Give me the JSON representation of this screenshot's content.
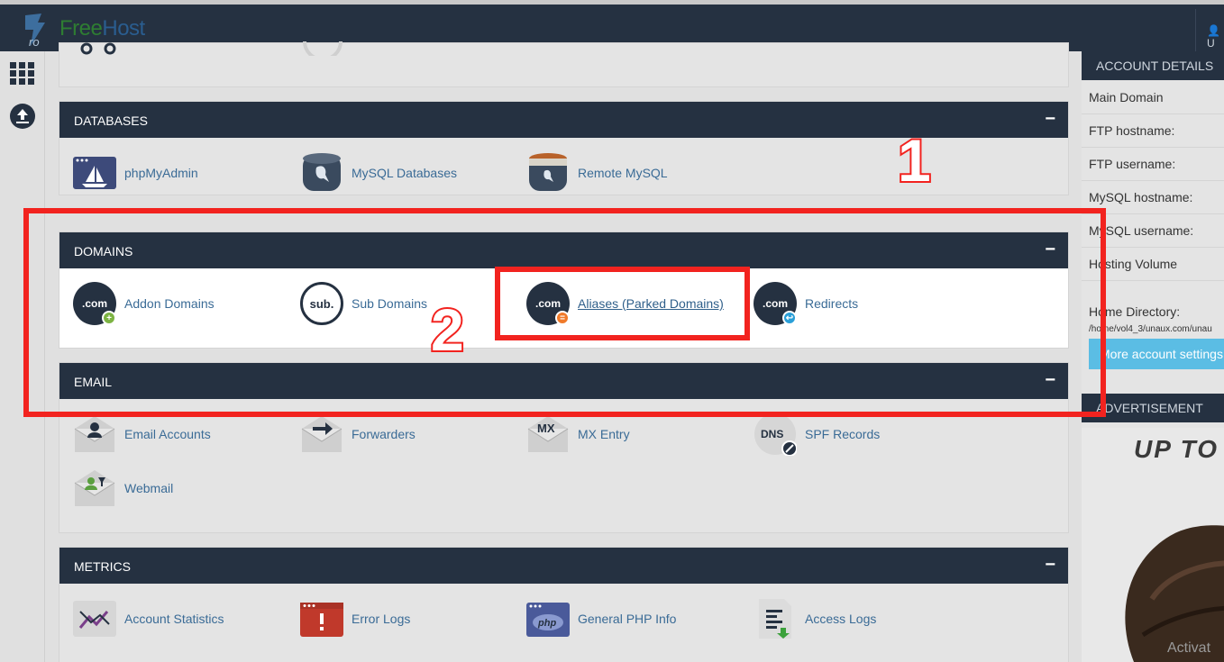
{
  "brand": {
    "free": "Free",
    "host": "Host",
    "mark": "ro"
  },
  "user": {
    "label": "U"
  },
  "panels": {
    "databases": {
      "title": "DATABASES",
      "items": [
        "phpMyAdmin",
        "MySQL Databases",
        "Remote MySQL"
      ]
    },
    "domains": {
      "title": "DOMAINS",
      "items": [
        "Addon Domains",
        "Sub Domains",
        "Aliases (Parked Domains)",
        "Redirects"
      ]
    },
    "email": {
      "title": "EMAIL",
      "items": [
        "Email Accounts",
        "Forwarders",
        "MX Entry",
        "SPF Records",
        "Webmail"
      ]
    },
    "metrics": {
      "title": "METRICS",
      "items": [
        "Account Statistics",
        "Error Logs",
        "General PHP Info",
        "Access Logs"
      ]
    }
  },
  "icons_text": {
    "com": ".com",
    "sub": "sub.",
    "mx": "MX",
    "dns": "DNS",
    "php": "php"
  },
  "collapse_symbol": "−",
  "account": {
    "title": "ACCOUNT DETAILS",
    "rows": [
      "Main Domain",
      "FTP hostname:",
      "FTP username:",
      "MySQL hostname:",
      "MySQL username:",
      "Hosting Volume"
    ],
    "home_label": "Home Directory:",
    "home_path": "/home/vol4_3/unaux.com/unau",
    "more_button": "More account settings"
  },
  "advertisement": {
    "title": "ADVERTISEMENT",
    "headline": "UP TO",
    "watermark": "Activat"
  },
  "annotations": {
    "one": "1",
    "two": "2"
  },
  "colors": {
    "navbar": "#253141",
    "link": "#3a6b96",
    "highlight": "#f2231f",
    "button": "#5bbde4"
  }
}
